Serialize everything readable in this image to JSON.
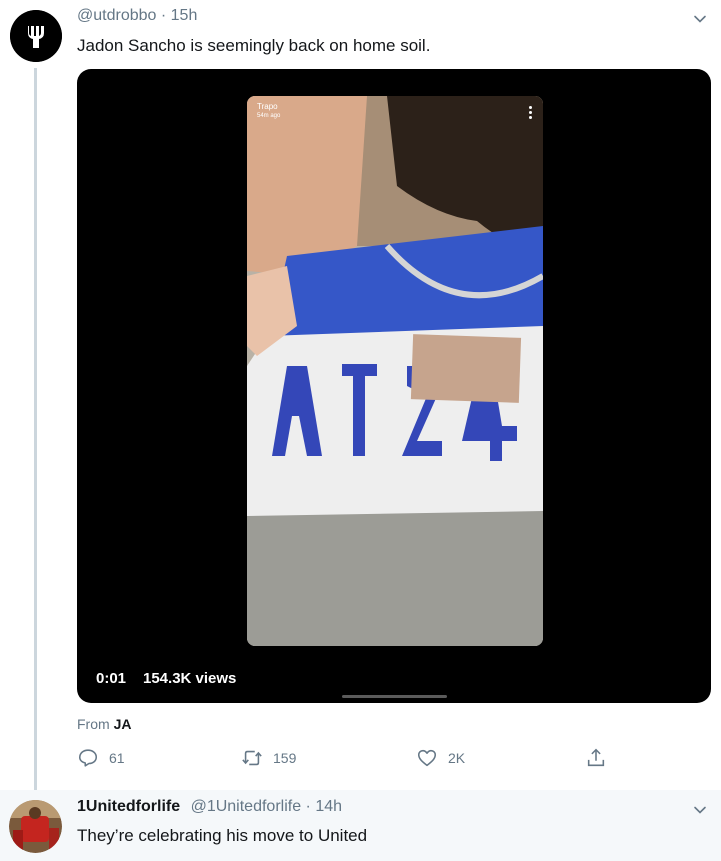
{
  "tweet1": {
    "handle": "@utdrobbo",
    "separator": "·",
    "time": "15h",
    "text": "Jadon Sancho is seemingly back on home soil.",
    "avatar_icon": "trident-icon",
    "media": {
      "snap_user": "Trapo",
      "snap_time": "54m ago",
      "video_time": "0:01",
      "video_views": "154.3K views"
    },
    "from_label": "From",
    "from_value": "JA",
    "actions": {
      "reply_count": "61",
      "retweet_count": "159",
      "like_count": "2K"
    }
  },
  "tweet2": {
    "name": "1Unitedforlife",
    "handle": "@1Unitedforlife",
    "separator": "·",
    "time": "14h",
    "text": "They’re celebrating his move to United"
  },
  "colors": {
    "secondary_text": "#657786",
    "thread_line": "#ccd6dd",
    "reply_background": "#f5f8fa"
  }
}
